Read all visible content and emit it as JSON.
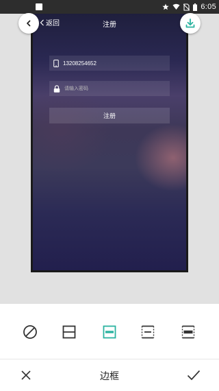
{
  "status_bar": {
    "time": "6:05",
    "icons": [
      "notification-square-icon",
      "star-icon",
      "wifi-icon",
      "no-sim-icon",
      "battery-icon"
    ]
  },
  "app_screen": {
    "back_label": "返回",
    "title": "注册",
    "phone_number": "13208254652",
    "password_placeholder": "请输入密码",
    "register_label": "注册"
  },
  "floating_buttons": {
    "back": "back-icon",
    "download": "download-icon",
    "download_color": "#2bb3a0"
  },
  "border_options": {
    "items": [
      "no-border-icon",
      "split-border-icon",
      "top-bottom-border-icon",
      "dashed-border-icon",
      "thick-bar-border-icon"
    ],
    "selected_index": 2,
    "accent_color": "#2bb3a0"
  },
  "bottom_bar": {
    "title": "边框",
    "cancel": "close-icon",
    "confirm": "check-icon"
  }
}
